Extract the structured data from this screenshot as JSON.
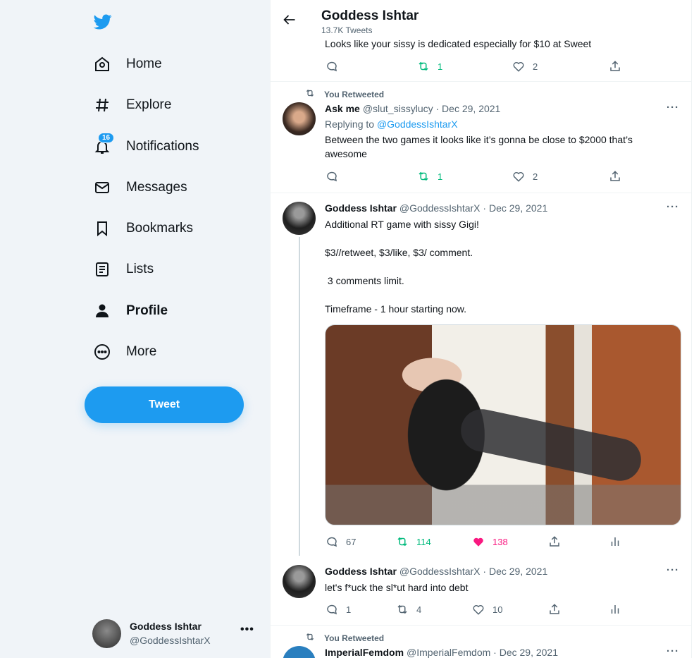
{
  "sidebar": {
    "nav": [
      {
        "label": "Home",
        "icon": "home-icon"
      },
      {
        "label": "Explore",
        "icon": "hashtag-icon"
      },
      {
        "label": "Notifications",
        "icon": "bell-icon",
        "badge": "16"
      },
      {
        "label": "Messages",
        "icon": "envelope-icon"
      },
      {
        "label": "Bookmarks",
        "icon": "bookmark-icon"
      },
      {
        "label": "Lists",
        "icon": "list-icon"
      },
      {
        "label": "Profile",
        "icon": "person-icon",
        "active": true
      },
      {
        "label": "More",
        "icon": "more-circle-icon"
      }
    ],
    "tweet_button": "Tweet",
    "account": {
      "display_name": "Goddess Ishtar",
      "username": "@GoddessIshtarX",
      "menu": "•••"
    }
  },
  "header": {
    "title": "Goddess Ishtar",
    "subtitle": "13.7K Tweets"
  },
  "tweets": [
    {
      "text": "Looks like your sissy is dedicated especially for $10 at Sweet",
      "actions": {
        "replies": "",
        "retweets": "1",
        "likes": "2"
      }
    },
    {
      "retweeted_by": "You Retweeted",
      "display_name": "Ask me",
      "username": "@slut_sissylucy",
      "date": "· Dec 29, 2021",
      "replying_prefix": "Replying to ",
      "replying_to": "@GoddessIshtarX",
      "text": "Between the two games it looks like it’s gonna be close to $2000 that’s awesome",
      "actions": {
        "replies": "",
        "retweets": "1",
        "likes": "2"
      }
    },
    {
      "display_name": "Goddess Ishtar",
      "username": "@GoddessIshtarX",
      "date": "· Dec 29, 2021",
      "lines": [
        "Additional RT game with sissy Gigi!",
        "$3//retweet, $3/like, $3/ comment.",
        " 3 comments limit.",
        "Timeframe - 1 hour starting now."
      ],
      "actions": {
        "replies": "67",
        "retweets": "114",
        "likes": "138"
      }
    },
    {
      "display_name": "Goddess Ishtar",
      "username": "@GoddessIshtarX",
      "date": "· Dec 29, 2021",
      "text": "let's f*uck the sl*ut hard into debt",
      "actions": {
        "replies": "1",
        "retweets": "4",
        "likes": "10"
      }
    },
    {
      "retweeted_by": "You Retweeted",
      "display_name": "ImperialFemdom",
      "username": "@ImperialFemdom",
      "date": "· Dec 29, 2021"
    }
  ],
  "colors": {
    "accent": "#1d9bf0",
    "retweet": "#00ba7c",
    "like": "#f91880",
    "muted": "#536471"
  }
}
